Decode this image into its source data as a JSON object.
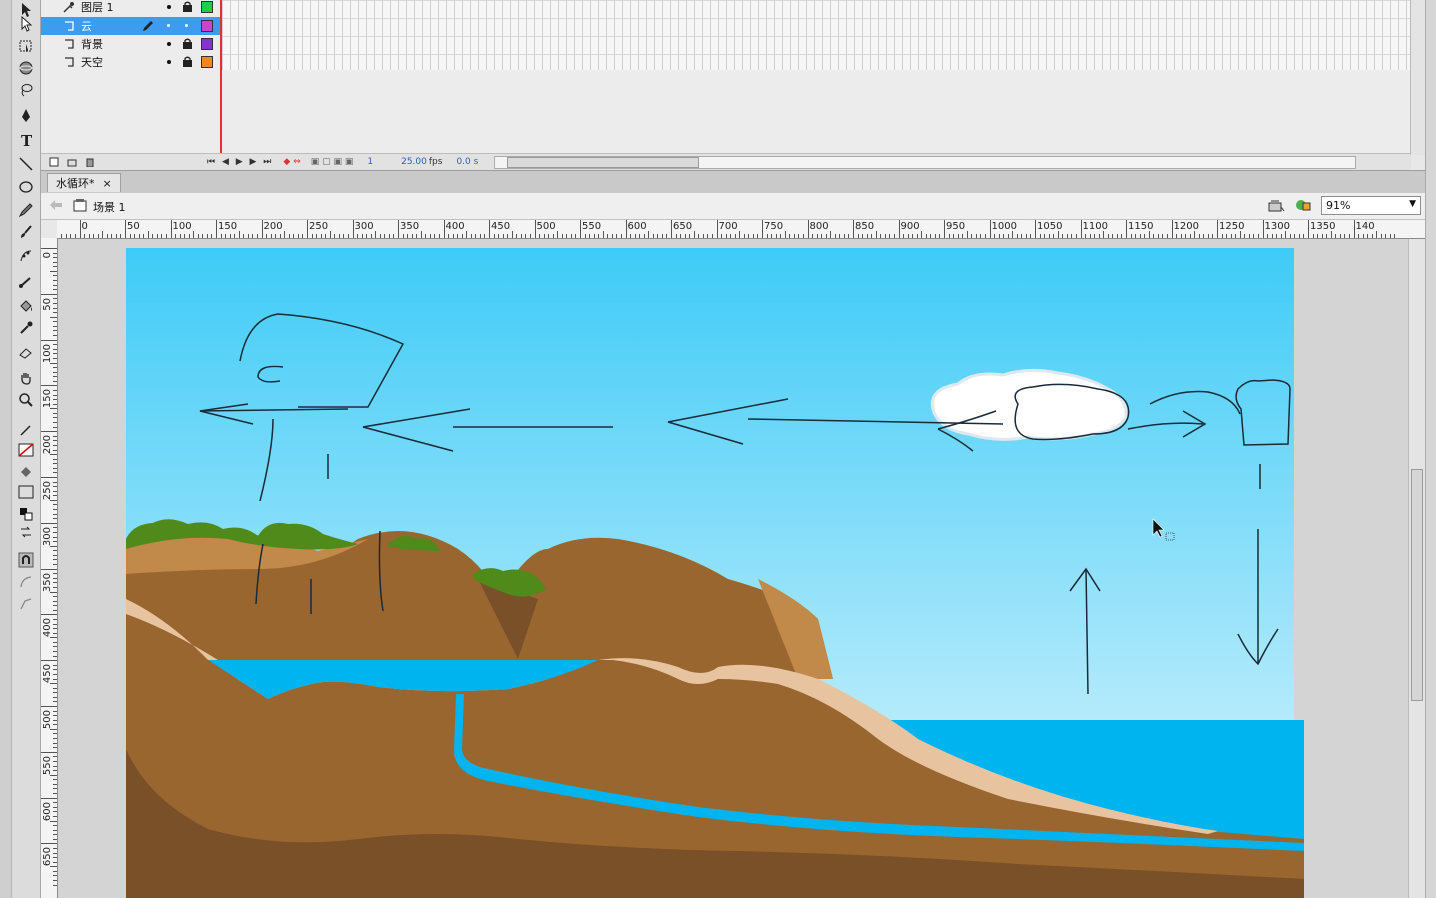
{
  "timeline": {
    "layers": [
      {
        "name": "图层 1",
        "color": "#22cc44",
        "selected": false,
        "icon": "layer-folder-icon"
      },
      {
        "name": "云",
        "color": "#cc44cc",
        "selected": true,
        "icon": "layer-icon"
      },
      {
        "name": "背景",
        "color": "#8833cc",
        "selected": false,
        "icon": "layer-icon"
      },
      {
        "name": "天空",
        "color": "#ee8822",
        "selected": false,
        "icon": "layer-icon"
      }
    ],
    "frame_number": "1",
    "fps": "25.00",
    "fps_unit": "fps",
    "time": "0.0 s"
  },
  "document": {
    "tab_title": "水循环*",
    "tab_close": "×",
    "scene": "场景 1",
    "zoom": "91%"
  },
  "ruler": {
    "h_labels": [
      "50",
      "0",
      "50",
      "100",
      "150",
      "200",
      "250",
      "300",
      "350",
      "400",
      "450",
      "500",
      "550",
      "600",
      "650",
      "700",
      "750",
      "800",
      "850",
      "900",
      "950",
      "1000",
      "1050",
      "1100",
      "1150",
      "1200",
      "1250",
      "1300",
      "1350",
      "140"
    ],
    "v_labels": [
      "0",
      "50",
      "100",
      "150",
      "200",
      "250",
      "300",
      "350",
      "400",
      "450",
      "500",
      "550",
      "600",
      "650"
    ]
  },
  "colors": {
    "sky_top": "#3ecbf7",
    "sky_bottom": "#e4f7fd",
    "sea": "#00b4f0",
    "earth": "#9a6630",
    "earth_dark": "#7a5028",
    "sand": "#e8c3a0",
    "grass": "#4f8a1a"
  }
}
